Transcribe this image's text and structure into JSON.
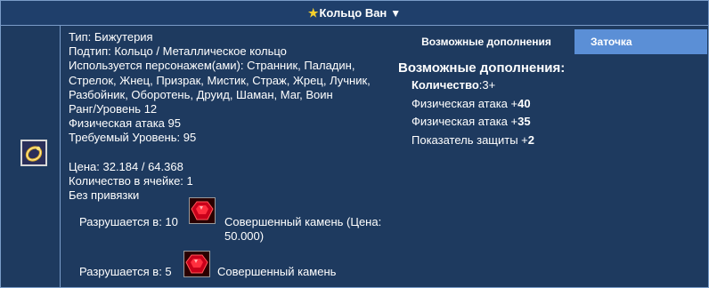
{
  "header": {
    "star_icon": "star-icon",
    "title": "Кольцо Ван",
    "arrow": "▼"
  },
  "colors": {
    "background": "#1e3a5f",
    "header": "#1f3f6b",
    "border": "#7a9cc8",
    "tab": "#5b8fd6",
    "star": "#f3cf2c"
  },
  "item": {
    "icon": "gold-ring-icon",
    "lines": [
      "Тип: Бижутерия",
      "Подтип: Кольцо / Металлическое кольцо",
      "Используется персонажем(ами): Странник, Паладин, Стрелок, Жнец, Призрак, Мистик, Страж, Жрец, Лучник, Разбойник, Оборотень, Друид, Шаман, Маг, Воин",
      "Ранг/Уровень 12",
      "Физическая атака 95",
      "Требуемый Уровень: 95"
    ],
    "lines2": [
      "Цена: 32.184 / 64.368",
      "Количество в ячейке: 1",
      "Без привязки"
    ]
  },
  "crafting": [
    {
      "prefix": "Разрушается в: 10",
      "gem_icon": "red-gem-icon",
      "text": "Совершенный камень (Цена: 50.000)"
    },
    {
      "prefix": "Разрушается в: 5",
      "gem_icon": "red-gem-icon",
      "text": "Совершенный камень"
    }
  ],
  "tabs": {
    "active": "Возможные дополнения",
    "other": "Заточка"
  },
  "additions": {
    "title": "Возможные дополнения:",
    "count_label": "Количество",
    "count_value": ":3+",
    "items": [
      {
        "label": "Физическая атака +",
        "value": "40"
      },
      {
        "label": "Физическая атака +",
        "value": "35"
      },
      {
        "label": "Показатель защиты +",
        "value": "2"
      }
    ]
  }
}
